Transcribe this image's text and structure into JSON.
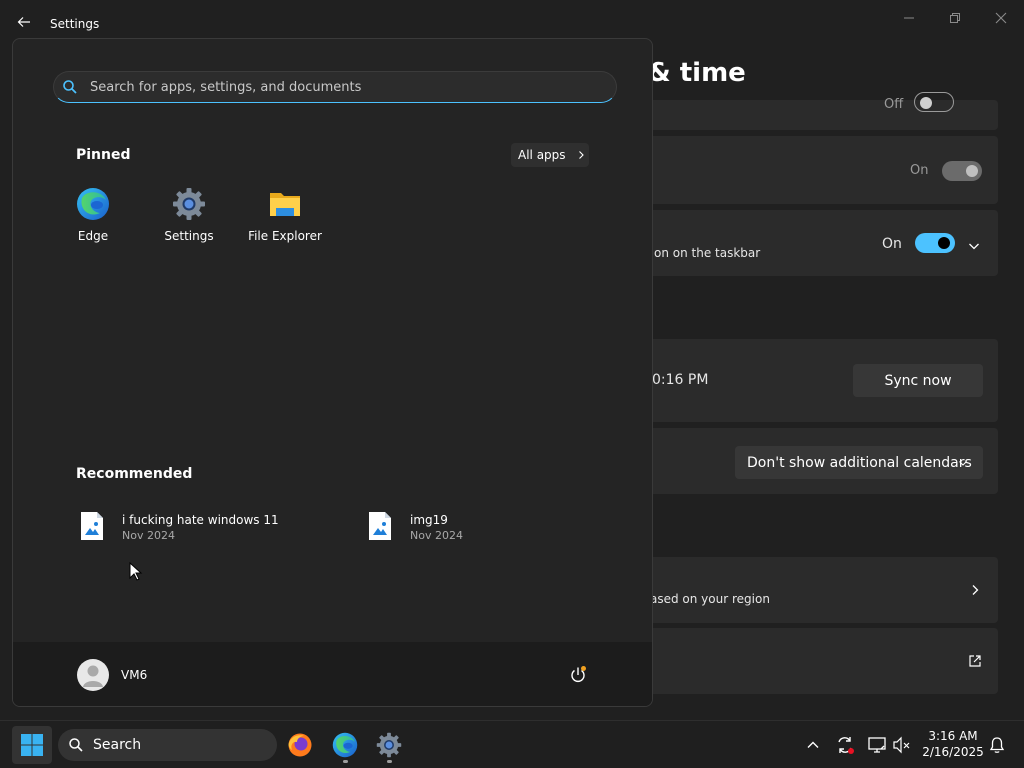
{
  "settings_window": {
    "title": "Settings",
    "page_heading": "& time",
    "card1_state": "Off",
    "card2_state": "On",
    "card3_state": "On",
    "card3_text": "on on the taskbar",
    "card4_text": "0:16 PM",
    "sync_button_label": "Sync now",
    "calendar_dropdown_value": "Don't show additional calendars",
    "card6_text": "ased on your region"
  },
  "start_menu": {
    "search_placeholder": "Search for apps, settings, and documents",
    "pinned_heading": "Pinned",
    "all_apps_label": "All apps",
    "pinned_apps": [
      {
        "label": "Edge",
        "icon": "edge-icon"
      },
      {
        "label": "Settings",
        "icon": "gear-icon"
      },
      {
        "label": "File Explorer",
        "icon": "folder-icon"
      }
    ],
    "recommended_heading": "Recommended",
    "recommended": [
      {
        "name": "i fucking hate windows 11",
        "date": "Nov 2024",
        "icon": "image-file-icon"
      },
      {
        "name": "img19",
        "date": "Nov 2024",
        "icon": "image-file-icon"
      }
    ],
    "user_name": "VM6"
  },
  "taskbar": {
    "search_label": "Search",
    "apps": [
      "firefox-icon",
      "edge-icon",
      "gear-icon"
    ],
    "time": "3:16 AM",
    "date": "2/16/2025"
  },
  "colors": {
    "accent": "#4cc2ff",
    "background": "#202020",
    "card": "#2b2b2b"
  }
}
